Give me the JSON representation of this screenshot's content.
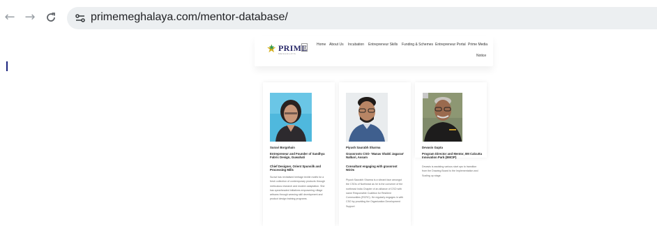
{
  "browser": {
    "url": "primemeghalaya.com/mentor-database/",
    "back_icon": "←",
    "forward_icon": "→",
    "reload_icon": "C"
  },
  "site": {
    "logo_text": "PRIME",
    "logo_subtitle": "MEGHALAYA",
    "nav": [
      {
        "label": "Home"
      },
      {
        "label": "About Us"
      },
      {
        "label": "Incubation"
      },
      {
        "label": "Entrepreneur Skills"
      },
      {
        "label": "Funding & Schemes"
      },
      {
        "label": "Entrepreneur Portal"
      },
      {
        "label": "Prime Media"
      },
      {
        "label": "Notice"
      }
    ]
  },
  "mentors": [
    {
      "name": "Suravi Borgohain",
      "role": "Entrepreneur and Founder of Sandhya Fabric Design, Guwahati",
      "role2": "Chief Designer, Orient Spunsilk and Processing Mills",
      "bio": "Suravi has revitalised heritage textile motifs for a fresh collection of contemporary products through meticulous research and modern adaptation. She has spearheaded initiatives empowering village artisans through weaving skill development and product design training programs."
    },
    {
      "name": "Piyush Saurabh Sharma",
      "role": "Grassroots CSO- 'Manav Shakti Jagaran' Nalbari, Assam",
      "role2": "Consultant engaging with grassroot NGOs",
      "bio": "Piyush Saurabh Sharma is a vibrant face amongst the CSOs of Northeast as he is the convener of the northeast India Chapter of an alliance of CSO with name Responsible Coalition for Resilient Communities (RCRC). He regularly engages in with CSO by providing the Organization Development Support"
    },
    {
      "name": "Devasis Gupta",
      "role": "Program Director and Mentor, IIM Calcutta Innovation Park (IIMCIP)",
      "role2": "",
      "bio": "Devasis is assisting various start ups to transition from the Drawing Board to the Implementation and Scaling up stage."
    }
  ],
  "colors": {
    "omnibox": "#eceff1",
    "logo_star": "#d4af1c",
    "logo_text": "#2a2a6a"
  }
}
